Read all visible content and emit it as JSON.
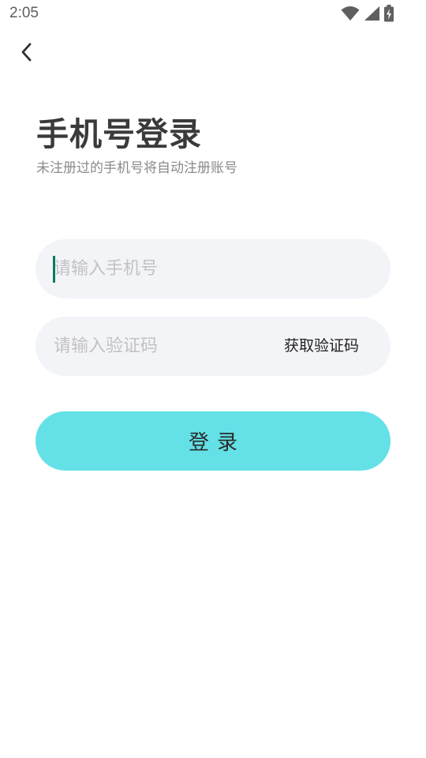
{
  "status_bar": {
    "time": "2:05",
    "icons": [
      "wifi-icon",
      "signal-icon",
      "battery-charging-icon"
    ]
  },
  "header": {
    "back_icon": "chevron-left-icon"
  },
  "main": {
    "title": "手机号登录",
    "subtitle": "未注册过的手机号将自动注册账号",
    "phone_input": {
      "placeholder": "请输入手机号",
      "value": ""
    },
    "code_input": {
      "placeholder": "请输入验证码",
      "value": ""
    },
    "get_code_label": "获取验证码",
    "login_label": "登录"
  },
  "colors": {
    "accent": "#63e1e7",
    "field_background": "#f3f4f8",
    "title_text": "#3a3a3a",
    "subtitle_text": "#8a8a8a",
    "placeholder_text": "#c2c2c6",
    "caret": "#0d7a5c"
  }
}
